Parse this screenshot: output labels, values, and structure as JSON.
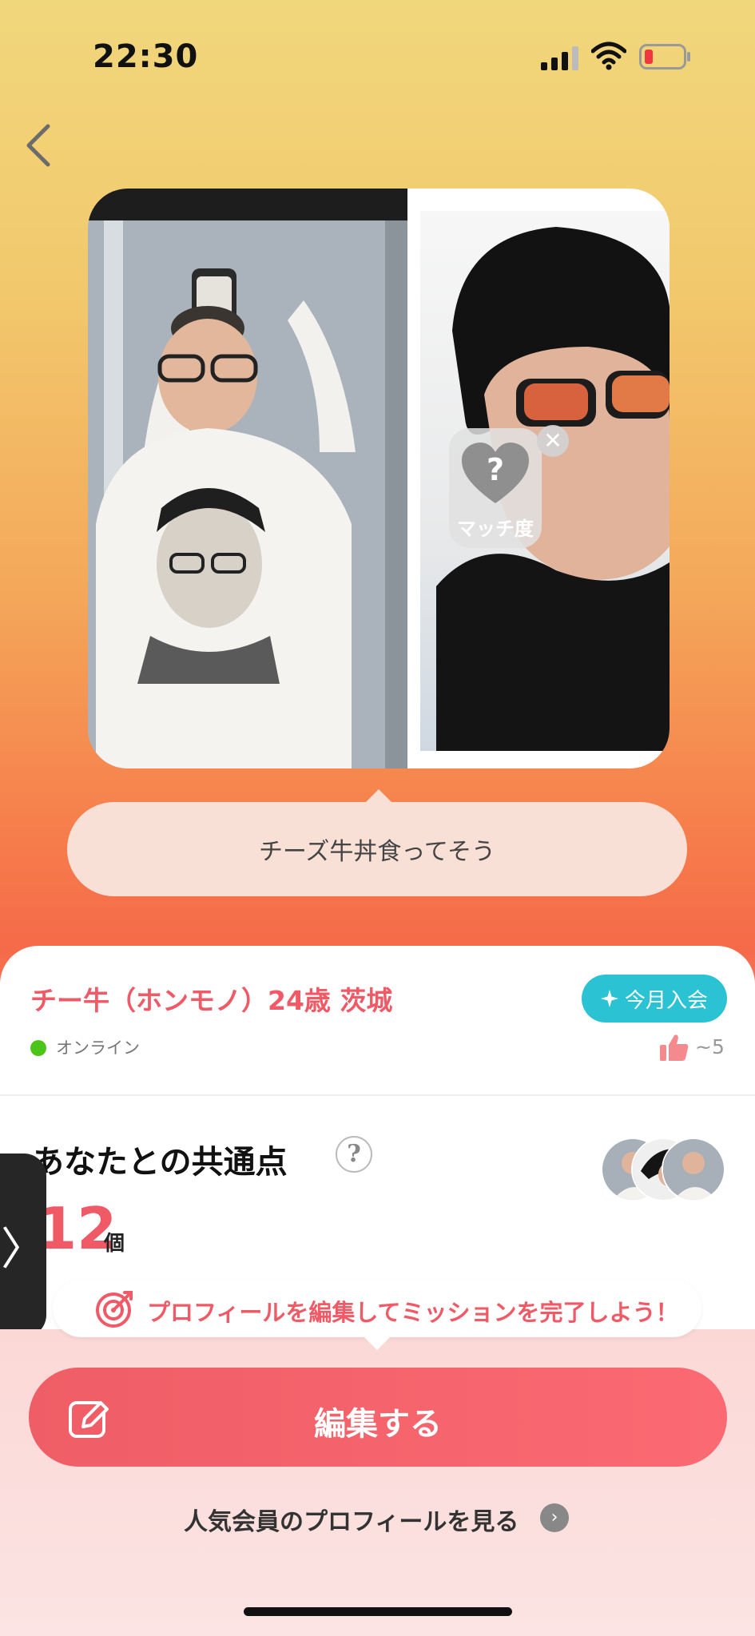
{
  "status_bar": {
    "time": "22:30"
  },
  "speech_bubble": {
    "text": "チーズ牛丼食ってそう"
  },
  "match_badge": {
    "symbol": "?",
    "label": "マッチ度",
    "close_symbol": "✕"
  },
  "profile": {
    "name_line": "チー牛（ホンモノ）24歳 茨城",
    "badge_label": "今月入会",
    "status": "オンライン",
    "likes": "~5"
  },
  "common": {
    "title": "あなたとの共通点",
    "help_symbol": "?",
    "count": "12",
    "unit": "個"
  },
  "side_tab": {
    "symbol": "〉"
  },
  "mission": {
    "text": "プロフィールを編集してミッションを完了しよう！"
  },
  "edit_button": {
    "label": "編集する"
  },
  "popular_link": {
    "label": "人気会員のプロフィールを見る",
    "arrow": "›"
  },
  "colors": {
    "accent": "#ef5a66",
    "badge": "#2bc3d3",
    "online": "#4cc51a"
  },
  "icons": {
    "back": "chevron-left-icon",
    "battery_state": "low"
  }
}
